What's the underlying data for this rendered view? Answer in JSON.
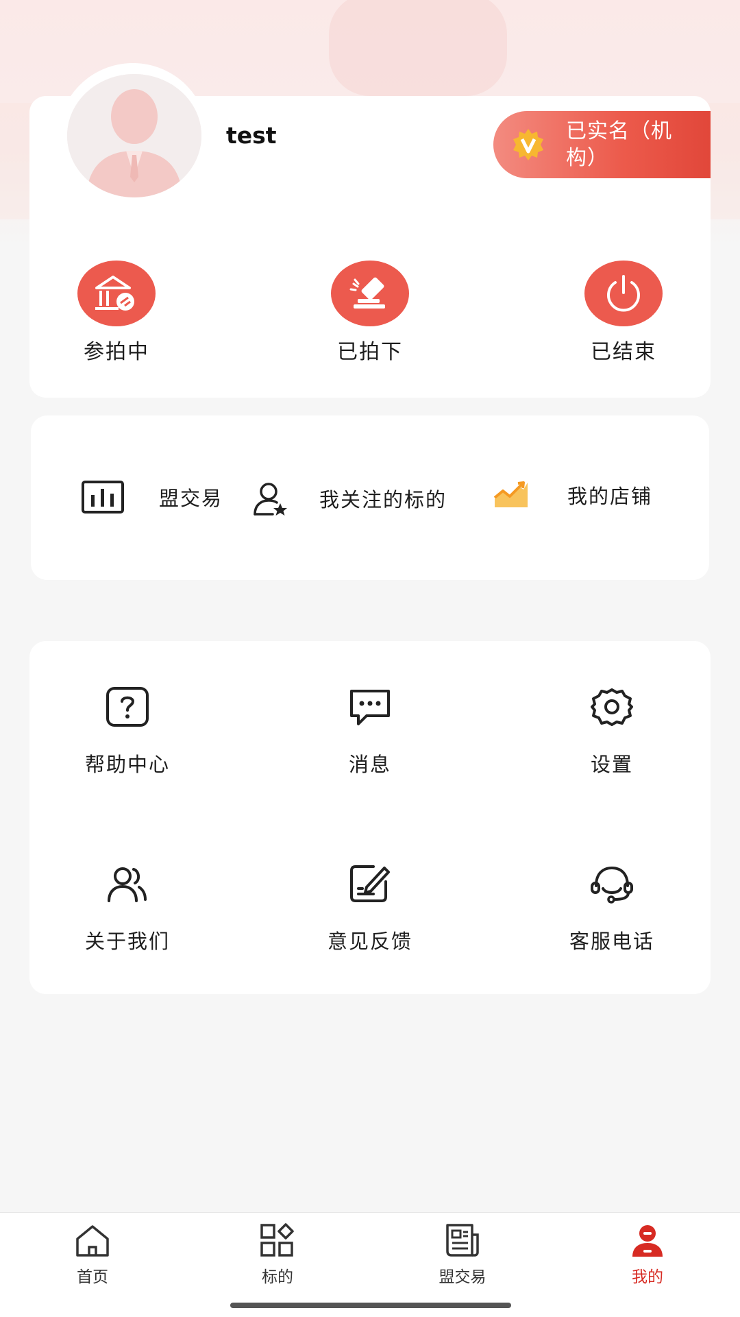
{
  "profile": {
    "username": "test",
    "verify_badge_line1": "已实名（机",
    "verify_badge_line2": "构）",
    "verify_badge_icon": "v-badge-icon"
  },
  "status_items": [
    {
      "label": "参拍中",
      "icon": "auction-house-icon"
    },
    {
      "label": "已拍下",
      "icon": "gavel-icon"
    },
    {
      "label": "已结束",
      "icon": "power-icon"
    }
  ],
  "quick_links": [
    {
      "label": "盟交易",
      "icon": "bar-chart-icon"
    },
    {
      "label": "我关注的标的",
      "icon": "user-star-icon"
    },
    {
      "label": "我的店铺",
      "icon": "trend-chart-icon"
    }
  ],
  "grid_items": [
    {
      "label": "帮助中心",
      "icon": "help-icon"
    },
    {
      "label": "消息",
      "icon": "message-icon"
    },
    {
      "label": "设置",
      "icon": "gear-icon"
    },
    {
      "label": "关于我们",
      "icon": "users-icon"
    },
    {
      "label": "意见反馈",
      "icon": "edit-note-icon"
    },
    {
      "label": "客服电话",
      "icon": "headset-icon"
    }
  ],
  "tabbar": [
    {
      "label": "首页",
      "icon": "home-icon"
    },
    {
      "label": "标的",
      "icon": "apps-icon"
    },
    {
      "label": "盟交易",
      "icon": "news-icon"
    },
    {
      "label": "我的",
      "icon": "profile-icon"
    }
  ],
  "colors": {
    "accent": "#ec5a4e",
    "active_tab": "#d72b23",
    "gold": "#f5b731",
    "orange_trend": "#f5a623"
  }
}
